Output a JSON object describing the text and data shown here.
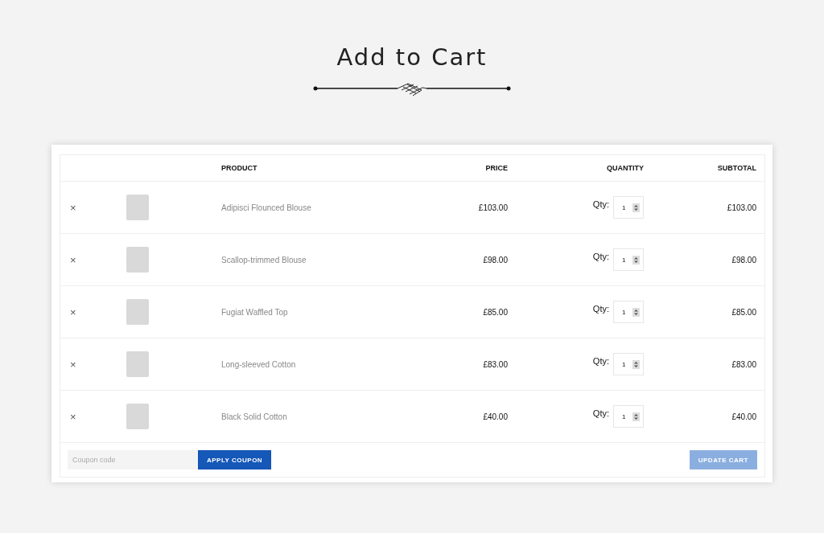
{
  "page_title": "Add to Cart",
  "table": {
    "columns": [
      "PRODUCT",
      "PRICE",
      "QUANTITY",
      "SUBTOTAL"
    ],
    "rows": [
      {
        "remove": "×",
        "product": "Adipisci Flounced Blouse",
        "price": "£103.00",
        "qty_label": "Qty:",
        "qty": "1",
        "subtotal": "£103.00"
      },
      {
        "remove": "×",
        "product": "Scallop-trimmed Blouse",
        "price": "£98.00",
        "qty_label": "Qty:",
        "qty": "1",
        "subtotal": "£98.00"
      },
      {
        "remove": "×",
        "product": "Fugiat Waffled Top",
        "price": "£85.00",
        "qty_label": "Qty:",
        "qty": "1",
        "subtotal": "£85.00"
      },
      {
        "remove": "×",
        "product": "Long-sleeved Cotton",
        "price": "£83.00",
        "qty_label": "Qty:",
        "qty": "1",
        "subtotal": "£83.00"
      },
      {
        "remove": "×",
        "product": "Black Solid Cotton",
        "price": "£40.00",
        "qty_label": "Qty:",
        "qty": "1",
        "subtotal": "£40.00"
      }
    ]
  },
  "coupon": {
    "placeholder": "Coupon code",
    "button": "APPLY COUPON"
  },
  "update_button": {
    "label": "UPDATE CART",
    "disabled": true
  }
}
